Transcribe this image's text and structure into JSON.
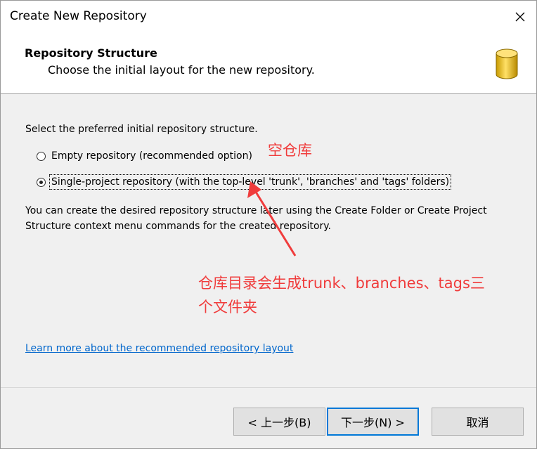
{
  "window": {
    "title": "Create New Repository"
  },
  "header": {
    "title": "Repository Structure",
    "subtitle": "Choose the initial layout for the new repository."
  },
  "content": {
    "prompt": "Select the preferred initial repository structure.",
    "options": [
      {
        "label": "Empty repository (recommended option)",
        "selected": false
      },
      {
        "label": "Single-project repository (with the top-level 'trunk', 'branches' and 'tags' folders)",
        "selected": true
      }
    ],
    "description_line1": "You can create the desired repository structure later using the Create Folder or Create Project",
    "description_line2": "Structure context menu commands for the created repository.",
    "link": "Learn more about the recommended repository layout"
  },
  "buttons": {
    "back": "< 上一步(B)",
    "next": "下一步(N) >",
    "cancel": "取消"
  },
  "annotations": {
    "empty_repo_note": "空仓库",
    "structure_note_line1": "仓库目录会生成trunk、branches、tags三",
    "structure_note_line2": "个文件夹",
    "color": "#f03c3c"
  }
}
